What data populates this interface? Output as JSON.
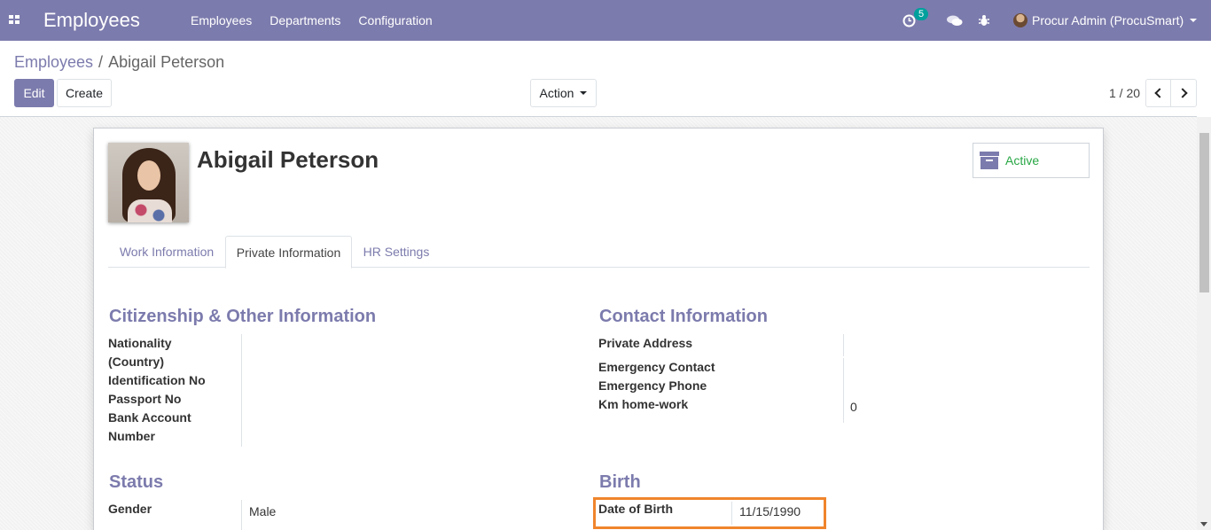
{
  "navbar": {
    "app_title": "Employees",
    "menu": [
      "Employees",
      "Departments",
      "Configuration"
    ],
    "activity_count": "5",
    "user_name": "Procur Admin (ProcuSmart)"
  },
  "breadcrumb": {
    "parent": "Employees",
    "separator": "/",
    "current": "Abigail Peterson"
  },
  "buttons": {
    "edit": "Edit",
    "create": "Create",
    "action": "Action"
  },
  "pager": {
    "value": "1 / 20"
  },
  "employee": {
    "name": "Abigail Peterson",
    "status": "Active"
  },
  "tabs": [
    "Work Information",
    "Private Information",
    "HR Settings"
  ],
  "citizenship": {
    "title": "Citizenship & Other Information",
    "nationality_label_line1": "Nationality",
    "nationality_label_line2": "(Country)",
    "identification_label": "Identification No",
    "passport_label": "Passport No",
    "bank_label_line1": "Bank Account",
    "bank_label_line2": "Number"
  },
  "contact": {
    "title": "Contact Information",
    "private_address_label": "Private Address",
    "emergency_contact_label": "Emergency Contact",
    "emergency_phone_label": "Emergency Phone",
    "km_label": "Km home-work",
    "km_value": "0"
  },
  "status_group": {
    "title": "Status",
    "gender_label": "Gender",
    "gender_value": "Male"
  },
  "birth": {
    "title": "Birth",
    "dob_label": "Date of Birth",
    "dob_value": "11/15/1990"
  },
  "colors": {
    "brand": "#7c7bad",
    "highlight": "#f0852d",
    "active": "#28a745"
  }
}
